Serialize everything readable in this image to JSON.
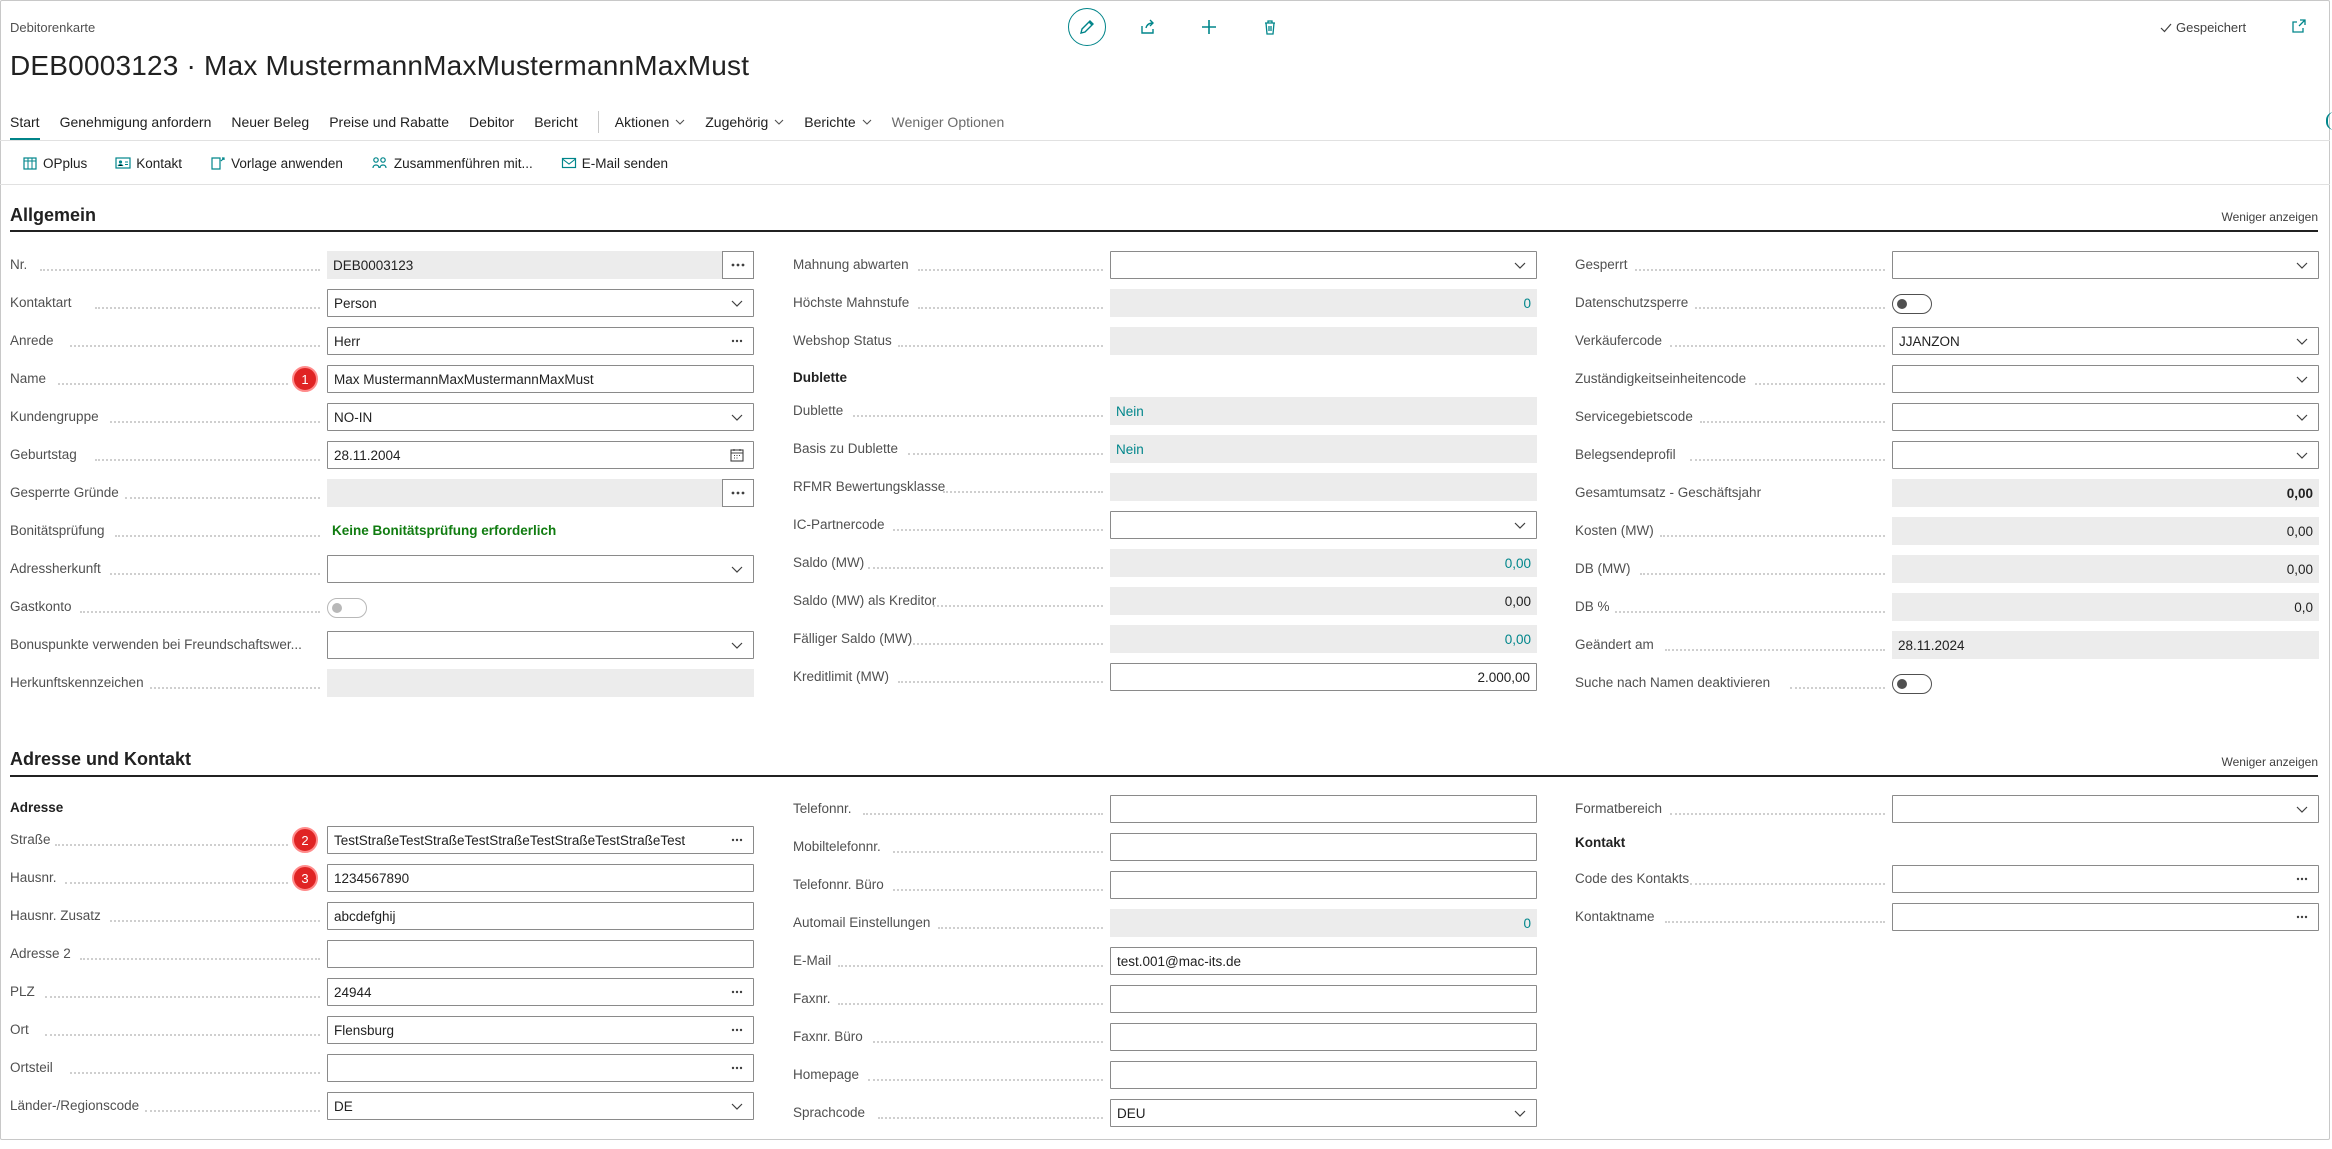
{
  "page": {
    "breadcrumb": "Debitorenkarte",
    "title": "DEB0003123 · Max MustermannMaxMustermannMaxMust",
    "saved_label": "Gespeichert",
    "accent": "#008489"
  },
  "menu": [
    {
      "label": "Start",
      "active": true
    },
    {
      "label": "Genehmigung anfordern"
    },
    {
      "label": "Neuer Beleg"
    },
    {
      "label": "Preise und Rabatte"
    },
    {
      "label": "Debitor"
    },
    {
      "label": "Bericht"
    },
    {
      "label": "Aktionen",
      "dropdown": true
    },
    {
      "label": "Zugehörig",
      "dropdown": true
    },
    {
      "label": "Berichte",
      "dropdown": true
    },
    {
      "label": "Weniger Optionen",
      "dim": true
    }
  ],
  "actions": [
    "OPplus",
    "Kontakt",
    "Vorlage anwenden",
    "Zusammenführen mit...",
    "E-Mail senden"
  ],
  "sections": {
    "allgemein": {
      "title": "Allgemein",
      "toggle_label": "Weniger anzeigen"
    },
    "adresse": {
      "title": "Adresse und Kontakt",
      "toggle_label": "Weniger anzeigen"
    }
  },
  "general": {
    "col1": {
      "nr": {
        "label": "Nr.",
        "value": "DEB0003123"
      },
      "kontaktart": {
        "label": "Kontaktart",
        "value": "Person"
      },
      "anrede": {
        "label": "Anrede",
        "value": "Herr"
      },
      "name": {
        "label": "Name",
        "value": "Max MustermannMaxMustermannMaxMust",
        "badge": "1"
      },
      "kundengruppe": {
        "label": "Kundengruppe",
        "value": "NO-IN"
      },
      "geburtstag": {
        "label": "Geburtstag",
        "value": "28.11.2004"
      },
      "gesperrte_gruende": {
        "label": "Gesperrte Gründe",
        "value": ""
      },
      "bonitaet": {
        "label": "Bonitätsprüfung",
        "value": "Keine Bonitätsprüfung erforderlich"
      },
      "adressherkunft": {
        "label": "Adressherkunft",
        "value": ""
      },
      "gastkonto": {
        "label": "Gastkonto"
      },
      "bonuspunkte": {
        "label": "Bonuspunkte verwenden bei Freundschaftswer...",
        "value": ""
      },
      "herkunftskennzeichen": {
        "label": "Herkunftskennzeichen",
        "value": ""
      }
    },
    "col2": {
      "mahnung": {
        "label": "Mahnung abwarten",
        "value": ""
      },
      "hoechste_mahnstufe": {
        "label": "Höchste Mahnstufe",
        "value": "0"
      },
      "webshop_status": {
        "label": "Webshop Status",
        "value": ""
      },
      "dublette_head": "Dublette",
      "dublette": {
        "label": "Dublette",
        "value": "Nein"
      },
      "basis_dublette": {
        "label": "Basis zu Dublette",
        "value": "Nein"
      },
      "rfmr": {
        "label": "RFMR Bewertungsklasse",
        "value": ""
      },
      "ic_partner": {
        "label": "IC-Partnercode",
        "value": ""
      },
      "saldo": {
        "label": "Saldo (MW)",
        "value": "0,00"
      },
      "saldo_kreditor": {
        "label": "Saldo (MW) als Kreditor",
        "value": "0,00"
      },
      "faelliger_saldo": {
        "label": "Fälliger Saldo (MW)",
        "value": "0,00"
      },
      "kreditlimit": {
        "label": "Kreditlimit (MW)",
        "value": "2.000,00"
      }
    },
    "col3": {
      "gesperrt": {
        "label": "Gesperrt",
        "value": ""
      },
      "datenschutzsperre": {
        "label": "Datenschutzsperre"
      },
      "verkaeufercode": {
        "label": "Verkäufercode",
        "value": "JJANZON"
      },
      "zustaendigkeit": {
        "label": "Zuständigkeitseinheitencode",
        "value": ""
      },
      "servicegebiet": {
        "label": "Servicegebietscode",
        "value": ""
      },
      "belegsendeprofil": {
        "label": "Belegsendeprofil",
        "value": ""
      },
      "gesamtumsatz": {
        "label": "Gesamtumsatz - Geschäftsjahr",
        "value": "0,00"
      },
      "kosten": {
        "label": "Kosten (MW)",
        "value": "0,00"
      },
      "db": {
        "label": "DB (MW)",
        "value": "0,00"
      },
      "db_pct": {
        "label": "DB %",
        "value": "0,0"
      },
      "geaendert": {
        "label": "Geändert am",
        "value": "28.11.2024"
      },
      "suche_namen": {
        "label": "Suche nach Namen deaktivieren"
      }
    }
  },
  "address": {
    "col1": {
      "head": "Adresse",
      "strasse": {
        "label": "Straße",
        "value": "TestStraßeTestStraßeTestStraßeTestStraßeTestStraßeTest",
        "badge": "2"
      },
      "hausnr": {
        "label": "Hausnr.",
        "value": "1234567890",
        "badge": "3"
      },
      "hausnr_zusatz": {
        "label": "Hausnr. Zusatz",
        "value": "abcdefghij"
      },
      "adresse2": {
        "label": "Adresse 2",
        "value": ""
      },
      "plz": {
        "label": "PLZ",
        "value": "24944"
      },
      "ort": {
        "label": "Ort",
        "value": "Flensburg"
      },
      "ortsteil": {
        "label": "Ortsteil",
        "value": ""
      },
      "land": {
        "label": "Länder-/Regionscode",
        "value": "DE"
      }
    },
    "col2": {
      "telefon": {
        "label": "Telefonnr.",
        "value": ""
      },
      "mobil": {
        "label": "Mobiltelefonnr.",
        "value": ""
      },
      "telefon_buero": {
        "label": "Telefonnr. Büro",
        "value": ""
      },
      "automail": {
        "label": "Automail Einstellungen",
        "value": "0"
      },
      "email": {
        "label": "E-Mail",
        "value": "test.001@mac-its.de"
      },
      "fax": {
        "label": "Faxnr.",
        "value": ""
      },
      "fax_buero": {
        "label": "Faxnr. Büro",
        "value": ""
      },
      "homepage": {
        "label": "Homepage",
        "value": ""
      },
      "sprachcode": {
        "label": "Sprachcode",
        "value": "DEU"
      }
    },
    "col3": {
      "formatbereich": {
        "label": "Formatbereich",
        "value": ""
      },
      "kontakt_head": "Kontakt",
      "code_kontakt": {
        "label": "Code des Kontakts",
        "value": ""
      },
      "kontaktname": {
        "label": "Kontaktname",
        "value": ""
      }
    }
  }
}
